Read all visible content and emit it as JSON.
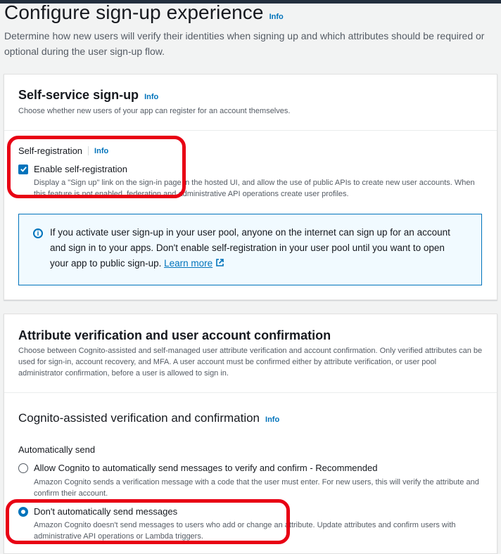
{
  "header": {
    "title": "Configure sign-up experience",
    "info": "Info",
    "description": "Determine how new users will verify their identities when signing up and which attributes should be required or optional during the user sign-up flow."
  },
  "self_service": {
    "title": "Self-service sign-up",
    "info": "Info",
    "description": "Choose whether new users of your app can register for an account themselves.",
    "field_label": "Self-registration",
    "field_info": "Info",
    "checkbox_label": "Enable self-registration",
    "checkbox_checked": true,
    "checkbox_desc": "Display a \"Sign up\" link on the sign-in page in the hosted UI, and allow the use of public APIs to create new user accounts. When this feature is not enabled, federation and administrative API operations create user profiles.",
    "alert_text": "If you activate user sign-up in your user pool, anyone on the internet can sign up for an account and sign in to your apps. Don't enable self-registration in your user pool until you want to open your app to public sign-up.",
    "alert_link": "Learn more"
  },
  "attribute_verification": {
    "title": "Attribute verification and user account confirmation",
    "description": "Choose between Cognito-assisted and self-managed user attribute verification and account confirmation. Only verified attributes can be used for sign-in, account recovery, and MFA. A user account must be confirmed either by attribute verification, or user pool administrator confirmation, before a user is allowed to sign in.",
    "subsection_title": "Cognito-assisted verification and confirmation",
    "subsection_info": "Info",
    "group_label": "Automatically send",
    "options": [
      {
        "label": "Allow Cognito to automatically send messages to verify and confirm - Recommended",
        "desc": "Amazon Cognito sends a verification message with a code that the user must enter. For new users, this will verify the attribute and confirm their account.",
        "selected": false
      },
      {
        "label": "Don't automatically send messages",
        "desc": "Amazon Cognito doesn't send messages to users who add or change an attribute. Update attributes and confirm users with administrative API operations or Lambda triggers.",
        "selected": true
      }
    ]
  },
  "colors": {
    "accent": "#0073bb",
    "highlight": "#e80014",
    "alert_bg": "#f1faff"
  }
}
